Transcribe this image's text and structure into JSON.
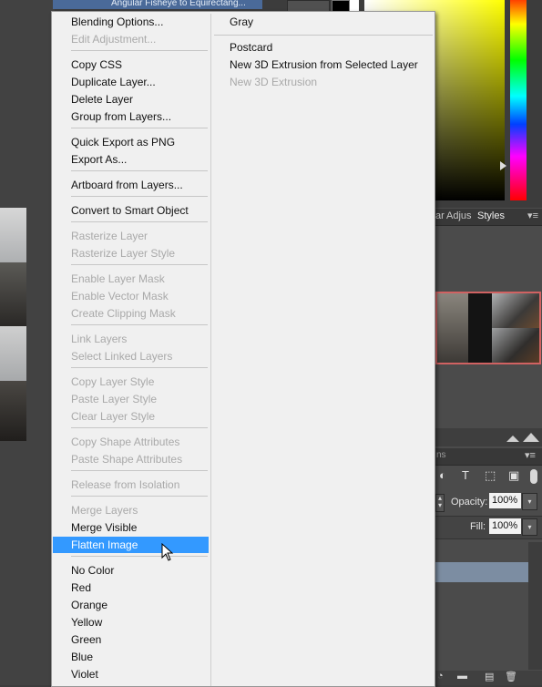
{
  "background": {
    "top_strip_text": "Angular Fisheye to Equirectang...",
    "panel_tabs": [
      "ar",
      "Adjus",
      "Styles"
    ],
    "layers_tab_fragment": "ns",
    "opacity": {
      "label": "Opacity:",
      "value": "100%"
    },
    "fill": {
      "label": "Fill:",
      "value": "100%"
    },
    "accent_color": "#3399ff"
  },
  "menu": {
    "column1": [
      {
        "label": "Blending Options...",
        "enabled": true
      },
      {
        "label": "Edit Adjustment...",
        "enabled": false
      },
      {
        "label": "Copy CSS",
        "enabled": true
      },
      {
        "label": "Duplicate Layer...",
        "enabled": true
      },
      {
        "label": "Delete Layer",
        "enabled": true
      },
      {
        "label": "Group from Layers...",
        "enabled": true
      },
      {
        "label": "Quick Export as PNG",
        "enabled": true
      },
      {
        "label": "Export As...",
        "enabled": true
      },
      {
        "label": "Artboard from Layers...",
        "enabled": true
      },
      {
        "label": "Convert to Smart Object",
        "enabled": true
      },
      {
        "label": "Rasterize Layer",
        "enabled": false
      },
      {
        "label": "Rasterize Layer Style",
        "enabled": false
      },
      {
        "label": "Enable Layer Mask",
        "enabled": false
      },
      {
        "label": "Enable Vector Mask",
        "enabled": false
      },
      {
        "label": "Create Clipping Mask",
        "enabled": false
      },
      {
        "label": "Link Layers",
        "enabled": false
      },
      {
        "label": "Select Linked Layers",
        "enabled": false
      },
      {
        "label": "Copy Layer Style",
        "enabled": false
      },
      {
        "label": "Paste Layer Style",
        "enabled": false
      },
      {
        "label": "Clear Layer Style",
        "enabled": false
      },
      {
        "label": "Copy Shape Attributes",
        "enabled": false
      },
      {
        "label": "Paste Shape Attributes",
        "enabled": false
      },
      {
        "label": "Release from Isolation",
        "enabled": false
      },
      {
        "label": "Merge Layers",
        "enabled": false
      },
      {
        "label": "Merge Visible",
        "enabled": true
      },
      {
        "label": "Flatten Image",
        "enabled": true,
        "highlighted": true
      },
      {
        "label": "No Color",
        "enabled": true
      },
      {
        "label": "Red",
        "enabled": true
      },
      {
        "label": "Orange",
        "enabled": true
      },
      {
        "label": "Yellow",
        "enabled": true
      },
      {
        "label": "Green",
        "enabled": true
      },
      {
        "label": "Blue",
        "enabled": true
      },
      {
        "label": "Violet",
        "enabled": true
      }
    ],
    "column2": [
      {
        "label": "Gray",
        "enabled": true
      },
      {
        "label": "Postcard",
        "enabled": true
      },
      {
        "label": "New 3D Extrusion from Selected Layer",
        "enabled": true
      },
      {
        "label": "New 3D Extrusion",
        "enabled": false
      }
    ]
  }
}
